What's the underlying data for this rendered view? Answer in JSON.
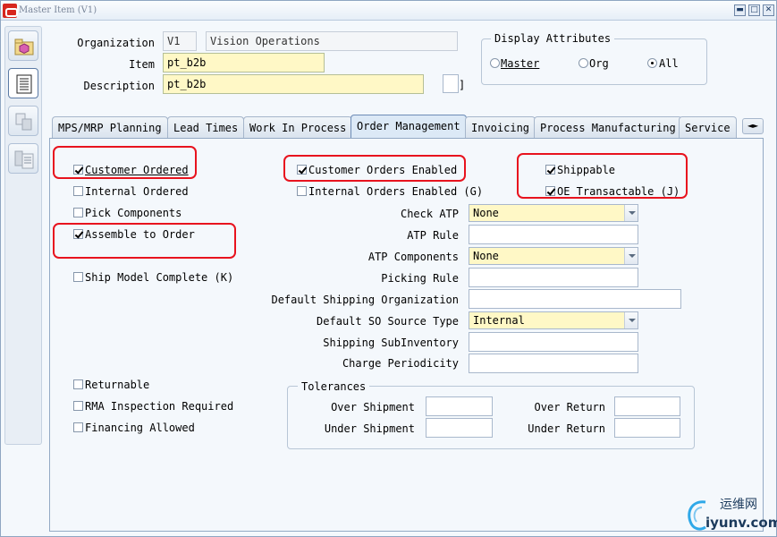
{
  "window": {
    "title": "Master Item (V1)",
    "minimize": "▬",
    "maximize": "□",
    "close": "✕"
  },
  "toolbar": {
    "icons": [
      "folder-cube-icon",
      "document-list-icon",
      "disabled-copy-icon",
      "disabled-list-icon"
    ]
  },
  "header": {
    "org_label": "Organization",
    "org_code": "V1",
    "org_name": "Vision Operations",
    "item_label": "Item",
    "item_value": "pt_b2b",
    "desc_label": "Description",
    "desc_value": "pt_b2b",
    "flex_bracket": "]"
  },
  "display_attributes": {
    "title": "Display Attributes",
    "options": [
      "Master",
      "Org",
      "All"
    ],
    "selected": "All"
  },
  "tabs": [
    "MPS/MRP Planning",
    "Lead Times",
    "Work In Process",
    "Order Management",
    "Invoicing",
    "Process Manufacturing",
    "Service"
  ],
  "active_tab": "Order Management",
  "tab_scroll": {
    "left": "◄",
    "right": "►"
  },
  "order_mgmt": {
    "customer_ordered": {
      "label": "Customer Ordered",
      "checked": true
    },
    "internal_ordered": {
      "label": "Internal Ordered",
      "checked": false
    },
    "pick_components": {
      "label": "Pick Components",
      "checked": false
    },
    "assemble_to_order": {
      "label": "Assemble to Order",
      "checked": true
    },
    "ship_model_complete": {
      "label": "Ship Model Complete (K)",
      "checked": false
    },
    "customer_orders_enabled": {
      "label": "Customer Orders Enabled",
      "checked": true
    },
    "internal_orders_enabled": {
      "label": "Internal Orders Enabled (G)",
      "checked": false
    },
    "shippable": {
      "label": "Shippable",
      "checked": true
    },
    "oe_transactable": {
      "label": "OE Transactable (J)",
      "checked": true
    },
    "check_atp": {
      "label": "Check ATP",
      "value": "None"
    },
    "atp_rule": {
      "label": "ATP Rule",
      "value": ""
    },
    "atp_components": {
      "label": "ATP Components",
      "value": "None"
    },
    "picking_rule": {
      "label": "Picking Rule",
      "value": ""
    },
    "default_shipping_org": {
      "label": "Default Shipping Organization",
      "value": ""
    },
    "default_so_source_type": {
      "label": "Default SO Source Type",
      "value": "Internal"
    },
    "shipping_subinventory": {
      "label": "Shipping SubInventory",
      "value": ""
    },
    "charge_periodicity": {
      "label": "Charge Periodicity",
      "value": ""
    },
    "returnable": {
      "label": "Returnable",
      "checked": false
    },
    "rma_inspection_required": {
      "label": "RMA Inspection Required",
      "checked": false
    },
    "financing_allowed": {
      "label": "Financing Allowed",
      "checked": false
    },
    "tolerances": {
      "title": "Tolerances",
      "over_shipment": "Over Shipment",
      "under_shipment": "Under Shipment",
      "over_return": "Over Return",
      "under_return": "Under Return"
    }
  },
  "watermark": {
    "cn": "运维网",
    "en": "iyunv.com"
  },
  "colors": {
    "required_field": "#fff8c6",
    "highlight_box": "#e8131e",
    "active_tab": "#dce9f6"
  }
}
